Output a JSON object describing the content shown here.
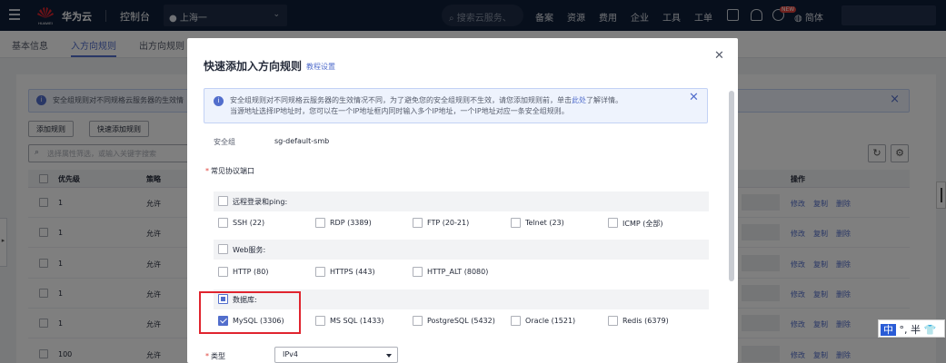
{
  "topbar": {
    "brand": "华为云",
    "logo_text": "HUAWEI",
    "console": "控制台",
    "region": "上海一",
    "search_placeholder": "搜索云服务、",
    "nav": [
      "备案",
      "资源",
      "费用",
      "企业",
      "工具",
      "工单"
    ],
    "badge": "NEW",
    "language": "简体"
  },
  "tabs": [
    "基本信息",
    "入方向规则",
    "出方向规则"
  ],
  "background": {
    "alert": "安全组规则对不同规格云服务器的生效情",
    "buttons": [
      "添加规则",
      "快速添加规则"
    ],
    "search_placeholder": "选择属性筛选，或输入关键字搜索",
    "headers": {
      "priority": "优先级",
      "policy": "策略",
      "actions": "操作"
    },
    "rows": [
      {
        "priority": "1",
        "policy": "允许"
      },
      {
        "priority": "1",
        "policy": "允许"
      },
      {
        "priority": "1",
        "policy": "允许"
      },
      {
        "priority": "1",
        "policy": "允许"
      },
      {
        "priority": "1",
        "policy": "允许"
      },
      {
        "priority": "100",
        "policy": "允许"
      }
    ],
    "actions": [
      "修改",
      "复制",
      "删除"
    ]
  },
  "modal": {
    "title": "快速添加入方向规则",
    "help": "教程设置",
    "alert_line1_pre": "安全组规则对不同规格云服务器的生效情况不同，为了避免您的安全组规则不生效，请您添加规则前，单击",
    "alert_link": "此处",
    "alert_line1_post": "了解详情。",
    "alert_line2": "当源地址选择IP地址时，您可以在一个IP地址框内同时输入多个IP地址，一个IP地址对应一条安全组规则。",
    "sg_label": "安全组",
    "sg_value": "sg-default-smb",
    "ports_label": "常见协议端口",
    "groups": [
      {
        "label": "远程登录和ping:",
        "options": [
          "SSH (22)",
          "RDP (3389)",
          "FTP (20-21)",
          "Telnet (23)",
          "ICMP (全部)"
        ]
      },
      {
        "label": "Web服务:",
        "options": [
          "HTTP (80)",
          "HTTPS (443)",
          "HTTP_ALT (8080)"
        ]
      },
      {
        "label": "数据库:",
        "options": [
          "MySQL (3306)",
          "MS SQL (1433)",
          "PostgreSQL (5432)",
          "Oracle (1521)",
          "Redis (6379)"
        ]
      }
    ],
    "type_label": "类型",
    "type_value": "IPv4"
  },
  "ime": {
    "mode": "中",
    "punct": "°,",
    "width": "半",
    "skin": "👕"
  },
  "colors": {
    "accent": "#526ecc",
    "topbar": "#0f1e38",
    "highlight": "#e0242e",
    "required": "#e0433c"
  }
}
